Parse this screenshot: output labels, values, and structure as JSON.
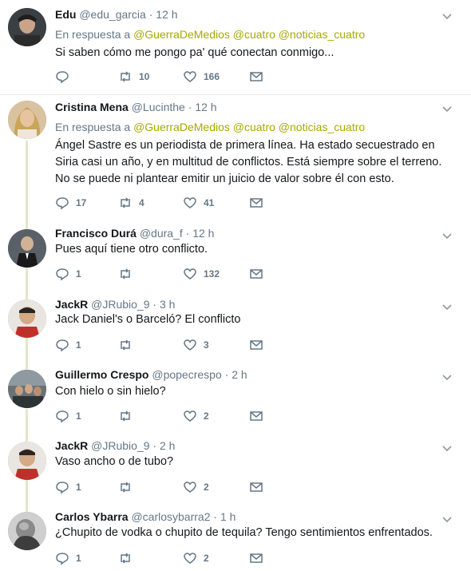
{
  "colors": {
    "mention": "#a6a900",
    "muted": "#657786",
    "thread_line": "#e1e8c8"
  },
  "reply_prefix": "En respuesta a",
  "tweets": [
    {
      "name": "Edu",
      "handle": "@edu_garcia",
      "time": "12 h",
      "reply_to": [
        "@GuerraDeMedios",
        "@cuatro",
        "@noticias_cuatro"
      ],
      "text": "Si saben cómo me pongo pa' qué conectan conmigo...",
      "replies": "",
      "retweets": "10",
      "likes": "166"
    },
    {
      "name": "Cristina Mena",
      "handle": "@Lucinthe",
      "time": "12 h",
      "reply_to": [
        "@GuerraDeMedios",
        "@cuatro",
        "@noticias_cuatro"
      ],
      "text": "Ángel Sastre es un periodista de primera línea. Ha estado secuestrado en Siria casi un año, y en multitud de conflictos. Está siempre sobre el terreno. No se puede ni plantear emitir un juicio de valor sobre él con esto.",
      "replies": "17",
      "retweets": "4",
      "likes": "41"
    },
    {
      "name": "Francisco Durá",
      "handle": "@dura_f",
      "time": "12 h",
      "text": "Pues aquí tiene otro conflicto.",
      "replies": "1",
      "retweets": "",
      "likes": "132"
    },
    {
      "name": "JackR",
      "handle": "@JRubio_9",
      "time": "3 h",
      "text": "Jack Daniel's o Barceló? El conflicto",
      "replies": "1",
      "retweets": "",
      "likes": "3"
    },
    {
      "name": "Guillermo Crespo",
      "handle": "@popecrespo",
      "time": "2 h",
      "text": "Con hielo o sin hielo?",
      "replies": "1",
      "retweets": "",
      "likes": "2"
    },
    {
      "name": "JackR",
      "handle": "@JRubio_9",
      "time": "2 h",
      "text": "Vaso ancho o de tubo?",
      "replies": "1",
      "retweets": "",
      "likes": "2"
    },
    {
      "name": "Carlos Ybarra",
      "handle": "@carlosybarra2",
      "time": "1 h",
      "text": "¿Chupito de vodka o chupito de tequila? Tengo sentimientos enfrentados.",
      "replies": "1",
      "retweets": "",
      "likes": "2"
    }
  ]
}
